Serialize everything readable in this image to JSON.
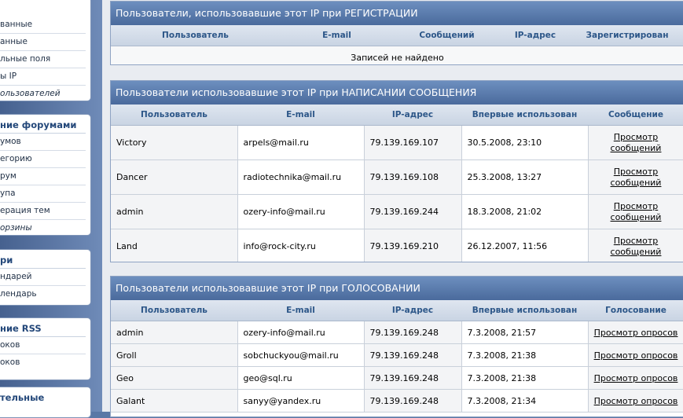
{
  "sidebar": {
    "box1": {
      "items": [
        "ванные",
        "анные",
        "льные поля",
        "ы IP",
        "ользователей"
      ]
    },
    "box2": {
      "title": "ние форумами",
      "items": [
        "умов",
        "егорию",
        "рум",
        "упа",
        "ерация тем",
        "орзины"
      ]
    },
    "box3": {
      "title": "ри",
      "items": [
        "ндарей",
        "лендарь"
      ]
    },
    "box4": {
      "title": "ние RSS",
      "items": [
        "оков",
        "оков"
      ]
    },
    "box5": {
      "title": "тельные"
    }
  },
  "registration": {
    "title": "Пользователи, использовавшие этот IP при РЕГИСТРАЦИИ",
    "headers": [
      "Пользователь",
      "E-mail",
      "Сообщений",
      "IP-адрес",
      "Зарегистрирован"
    ],
    "empty_text": "Записей не найдено"
  },
  "posting": {
    "title": "Пользователи использовавшие этот IP при НАПИСАНИИ СООБЩЕНИЯ",
    "headers": [
      "Пользователь",
      "E-mail",
      "IP-адрес",
      "Впервые использован",
      "Сообщение"
    ],
    "rows": [
      {
        "user": "Victory",
        "email": "arpels@mail.ru",
        "ip": "79.139.169.107",
        "first": "30.5.2008, 23:10",
        "link1": "Просмотр",
        "link2": "сообщений"
      },
      {
        "user": "Dancer",
        "email": "radiotechnika@mail.ru",
        "ip": "79.139.169.108",
        "first": "25.3.2008, 13:27",
        "link1": "Просмотр",
        "link2": "сообщений"
      },
      {
        "user": "admin",
        "email": "ozery-info@mail.ru",
        "ip": "79.139.169.244",
        "first": "18.3.2008, 21:02",
        "link1": "Просмотр",
        "link2": "сообщений"
      },
      {
        "user": "Land",
        "email": "info@rock-city.ru",
        "ip": "79.139.169.210",
        "first": "26.12.2007, 11:56",
        "link1": "Просмотр",
        "link2": "сообщений"
      }
    ]
  },
  "voting": {
    "title": "Пользователи использовавшие этот IP при ГОЛОСОВАНИИ",
    "headers": [
      "Пользователь",
      "E-mail",
      "IP-адрес",
      "Впервые использован",
      "Голосование"
    ],
    "rows": [
      {
        "user": "admin",
        "email": "ozery-info@mail.ru",
        "ip": "79.139.169.248",
        "first": "7.3.2008, 21:57",
        "link": "Просмотр опросов"
      },
      {
        "user": "Groll",
        "email": "sobchuckyou@mail.ru",
        "ip": "79.139.169.248",
        "first": "7.3.2008, 21:38",
        "link": "Просмотр опросов"
      },
      {
        "user": "Geo",
        "email": "geo@sql.ru",
        "ip": "79.139.169.248",
        "first": "7.3.2008, 21:38",
        "link": "Просмотр опросов"
      },
      {
        "user": "Galant",
        "email": "sanyy@yandex.ru",
        "ip": "79.139.169.248",
        "first": "7.3.2008, 21:34",
        "link": "Просмотр опросов"
      }
    ]
  }
}
